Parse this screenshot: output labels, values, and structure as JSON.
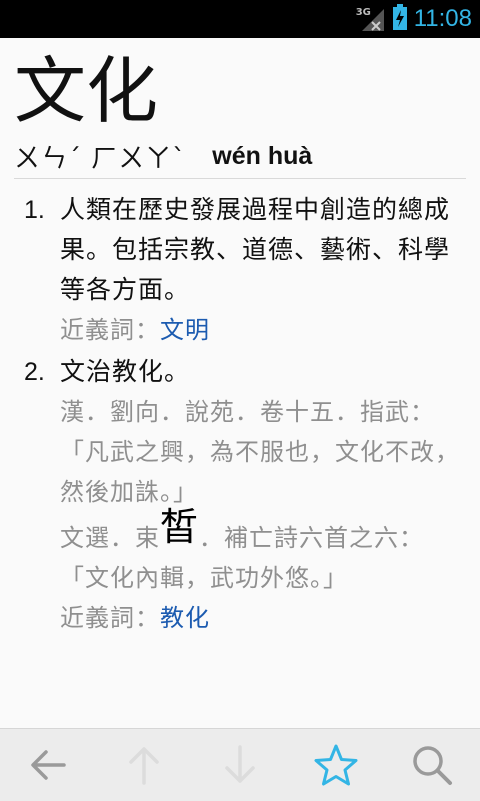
{
  "status": {
    "network": "3G",
    "time": "11:08"
  },
  "entry": {
    "headword": "文化",
    "bopomofo": "ㄨㄣˊ ㄏㄨㄚˋ",
    "pinyin": "wén huà"
  },
  "definitions": [
    {
      "number": "1.",
      "text": "人類在歷史發展過程中創造的總成果。包括宗教、道德、藝術、科學等各方面。",
      "synonym_label": "近義詞：",
      "synonym": "文明"
    },
    {
      "number": "2.",
      "text": "文治教化。",
      "citations": [
        {
          "source": "漢．劉向．說苑．卷十五．指武：",
          "quote": "「凡武之興，為不服也，文化不改，然後加誅。」"
        },
        {
          "source_pre": "文選．束",
          "source_glyph": "皙",
          "source_post": "．補亡詩六首之六：",
          "quote": "「文化內輯，武功外悠。」"
        }
      ],
      "synonym_label": "近義詞：",
      "synonym": "教化"
    }
  ],
  "toolbar": {
    "icons": [
      "back-arrow-icon",
      "up-arrow-icon",
      "down-arrow-icon",
      "star-icon",
      "search-icon"
    ],
    "accent": "#33b5e5"
  }
}
